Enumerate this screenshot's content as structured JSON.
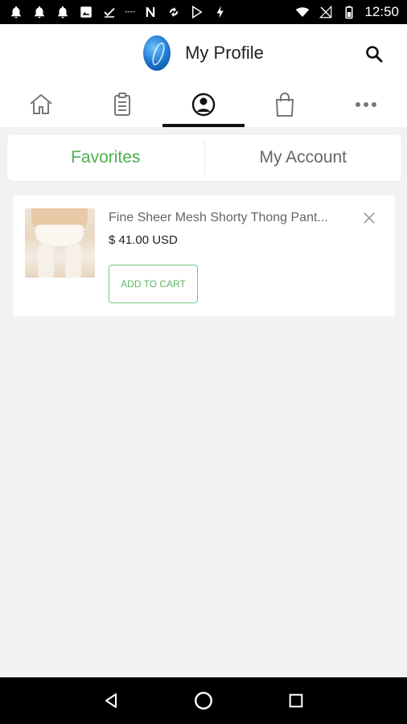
{
  "status_bar": {
    "time": "12:50",
    "small_text": "----",
    "left_icons": [
      "bell-icon",
      "bell-icon",
      "bell-icon",
      "image-icon",
      "download-done-icon",
      "n-icon",
      "sync-icon",
      "play-store-icon",
      "flash-icon"
    ],
    "right_icons": [
      "wifi-icon",
      "no-signal-icon",
      "battery-icon"
    ]
  },
  "header": {
    "title": "My Profile",
    "logo": "app-logo-icon",
    "search_icon": "search-icon"
  },
  "tabbar": {
    "tabs": [
      {
        "icon": "home-icon",
        "active": false
      },
      {
        "icon": "clipboard-icon",
        "active": false
      },
      {
        "icon": "profile-icon",
        "active": true
      },
      {
        "icon": "shopping-bag-icon",
        "active": false
      },
      {
        "icon": "more-icon",
        "active": false
      }
    ]
  },
  "segment": {
    "favorites_label": "Favorites",
    "account_label": "My Account",
    "active": "Favorites",
    "active_color": "#4caf50"
  },
  "favorites": {
    "items": [
      {
        "name": "Fine Sheer Mesh Shorty Thong Pant...",
        "price": "$ 41.00 USD",
        "button_label": "ADD TO CART",
        "remove_icon": "close-icon"
      }
    ]
  },
  "navbar": {
    "buttons": [
      "back-icon",
      "home-circle-icon",
      "recents-icon"
    ]
  }
}
